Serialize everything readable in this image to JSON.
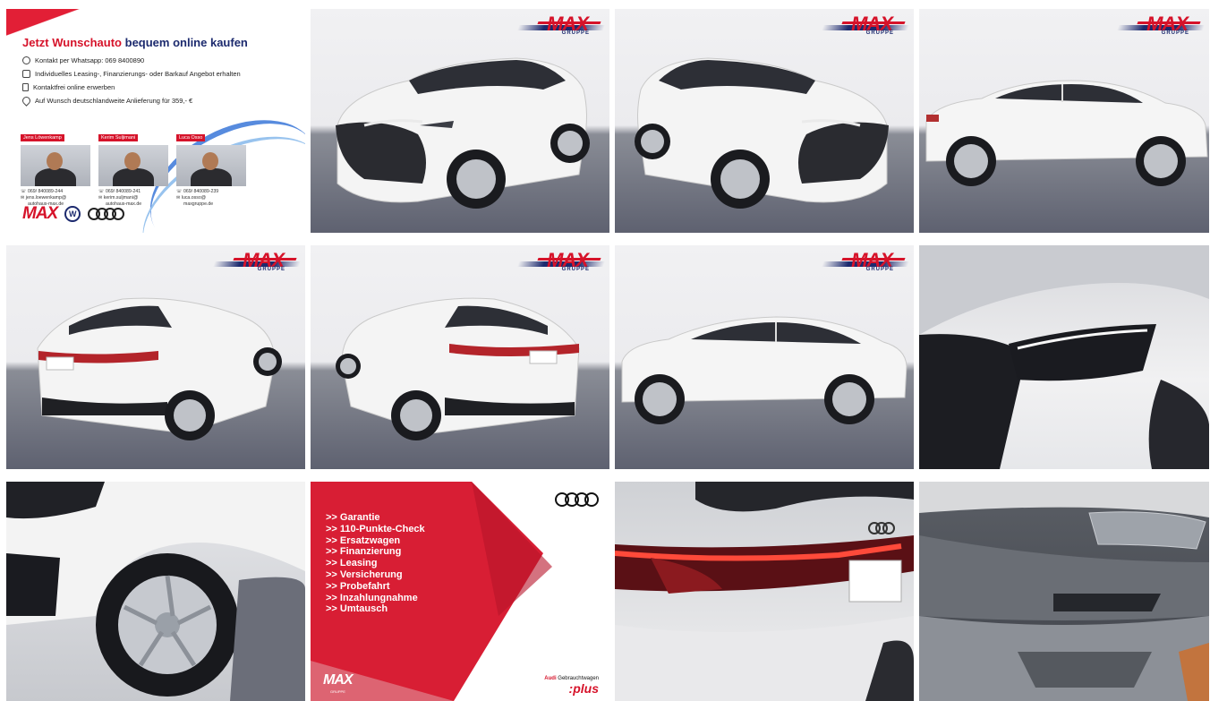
{
  "brand": {
    "accent": "#d6132a",
    "navy": "#1c2a6e"
  },
  "promo": {
    "headline_red": "Jetzt Wunschauto",
    "headline_blue": "bequem online kaufen",
    "lines": [
      {
        "icon": "whatsapp-icon",
        "text": "Kontakt per Whatsapp: 069 8400890"
      },
      {
        "icon": "offer-icon",
        "text": "Individuelles Leasing-, Finanzierungs- oder Barkauf Angebot erhalten"
      },
      {
        "icon": "phone-icon",
        "text": "Kontaktfrei online erwerben"
      },
      {
        "icon": "location-pin-icon",
        "text": "Auf Wunsch deutschlandweite Anlieferung für 359,- €"
      }
    ],
    "people": [
      {
        "name": "Jens Löwenkamp",
        "phone": "069/ 840089-244",
        "email": "jens.loewenkamp@",
        "domain": "autohaus-max.de"
      },
      {
        "name": "Kerim Suljimani",
        "phone": "069/ 840089-241",
        "email": "kerim.suljmani@",
        "domain": "autohaus-max.de"
      },
      {
        "name": "Luca Osso",
        "phone": "069/ 840089-239",
        "email": "luca.osso@",
        "domain": "maxgruppe.de"
      }
    ],
    "logo_text": "MAX"
  },
  "watermark": {
    "text": "MAX",
    "sub": "GRUPPE"
  },
  "services": {
    "items": [
      ">> Garantie",
      ">> 110-Punkte-Check",
      ">> Ersatzwagen",
      ">> Finanzierung",
      ">> Leasing",
      ">> Versicherung",
      ">> Probefahrt",
      ">> Inzahlungnahme",
      ">> Umtausch"
    ],
    "logo_text": "MAX",
    "logo_sub": "GRUPPE",
    "badge_brand": "Audi",
    "badge_text": "Gebrauchtwagen",
    "badge_plus": ":plus"
  }
}
